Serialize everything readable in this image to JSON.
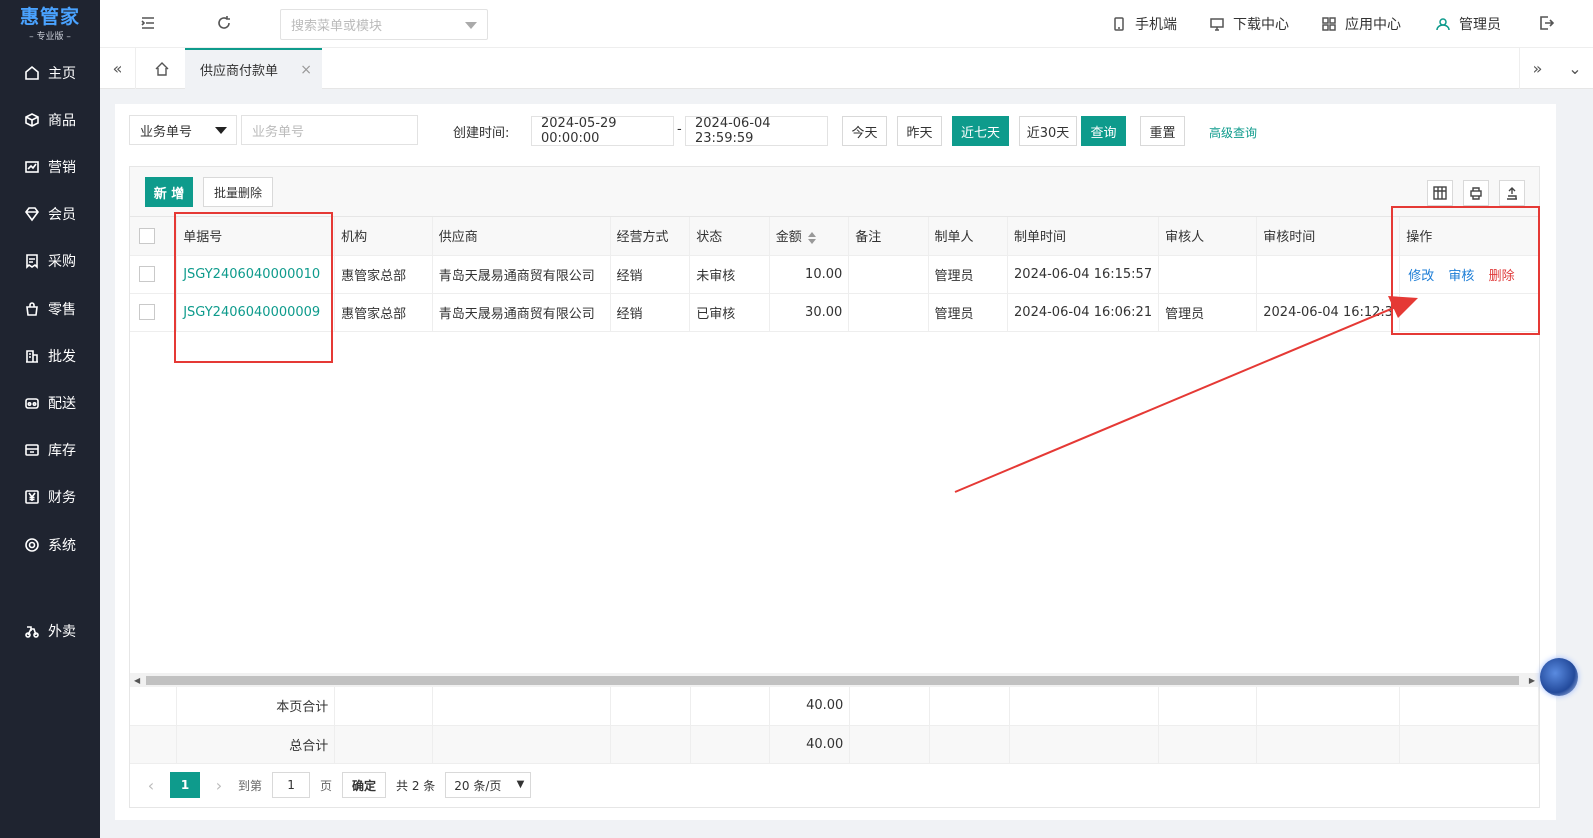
{
  "app": {
    "brand": "惠管家",
    "edition": "– 专业版 –"
  },
  "sidebar": {
    "items": [
      {
        "label": "主页",
        "icon": "home-icon"
      },
      {
        "label": "商品",
        "icon": "box-icon"
      },
      {
        "label": "营销",
        "icon": "chart-icon"
      },
      {
        "label": "会员",
        "icon": "diamond-icon"
      },
      {
        "label": "采购",
        "icon": "receipt-icon"
      },
      {
        "label": "零售",
        "icon": "bag-icon"
      },
      {
        "label": "批发",
        "icon": "building-icon"
      },
      {
        "label": "配送",
        "icon": "delivery-icon"
      },
      {
        "label": "库存",
        "icon": "storage-icon"
      },
      {
        "label": "财务",
        "icon": "yen-icon"
      },
      {
        "label": "系统",
        "icon": "settings-icon"
      },
      {
        "label": "外卖",
        "icon": "scooter-icon"
      }
    ]
  },
  "topbar": {
    "search_placeholder": "搜索菜单或模块",
    "mobile": "手机端",
    "download": "下载中心",
    "apps": "应用中心",
    "user": "管理员"
  },
  "tabs": {
    "active": "供应商付款单"
  },
  "filters": {
    "field_select": "业务单号",
    "field_placeholder": "业务单号",
    "created_label": "创建时间:",
    "date_start": "2024-05-29 00:00:00",
    "date_sep": "-",
    "date_end": "2024-06-04 23:59:59",
    "today": "今天",
    "yesterday": "昨天",
    "last7": "近七天",
    "last30": "近30天",
    "query": "查询",
    "reset": "重置",
    "advanced": "高级查询"
  },
  "toolbar": {
    "add": "新 增",
    "batch_delete": "批量删除"
  },
  "table": {
    "headers": {
      "doc_no": "单据号",
      "org": "机构",
      "supplier": "供应商",
      "mode": "经营方式",
      "status": "状态",
      "amount": "金额",
      "remark": "备注",
      "maker": "制单人",
      "make_time": "制单时间",
      "auditor": "审核人",
      "audit_time": "审核时间",
      "actions": "操作"
    },
    "rows": [
      {
        "doc_no": "JSGY2406040000010",
        "org": "惠管家总部",
        "supplier": "青岛天晟易通商贸有限公司",
        "mode": "经销",
        "status": "未审核",
        "amount": "10.00",
        "remark": "",
        "maker": "管理员",
        "make_time": "2024-06-04 16:15:57",
        "auditor": "",
        "audit_time": "",
        "act_edit": "修改",
        "act_audit": "审核",
        "act_delete": "删除"
      },
      {
        "doc_no": "JSGY2406040000009",
        "org": "惠管家总部",
        "supplier": "青岛天晟易通商贸有限公司",
        "mode": "经销",
        "status": "已审核",
        "amount": "30.00",
        "remark": "",
        "maker": "管理员",
        "make_time": "2024-06-04 16:06:21",
        "auditor": "管理员",
        "audit_time": "2024-06-04 16:12:3"
      }
    ],
    "page_total_label": "本页合计",
    "page_total": "40.00",
    "grand_total_label": "总合计",
    "grand_total": "40.00"
  },
  "pager": {
    "current": "1",
    "goto_label": "到第",
    "goto_value": "1",
    "page_unit": "页",
    "confirm": "确定",
    "total_text": "共 2 条",
    "page_size": "20 条/页"
  },
  "colors": {
    "accent": "#0e9b8c",
    "sidebar_bg": "#1f2430",
    "annotation_red": "#e53935"
  }
}
